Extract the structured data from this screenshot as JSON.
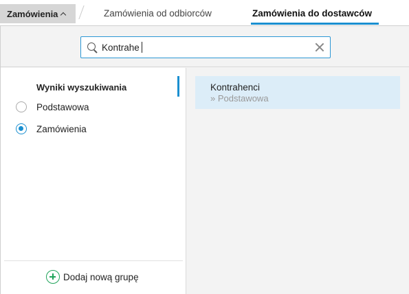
{
  "topbar": {
    "menu_label": "Zamówienia",
    "tabs": [
      {
        "label": "Zamówienia od odbiorców",
        "active": false
      },
      {
        "label": "Zamówienia do dostawców",
        "active": true
      }
    ],
    "accent_color": "#1a8fd0"
  },
  "search": {
    "value": "Kontrahe",
    "icon": "search-icon",
    "clear_icon": "close-icon"
  },
  "left": {
    "header": "Wyniki wyszukiwania",
    "groups": [
      {
        "label": "Podstawowa",
        "selected": false
      },
      {
        "label": "Zamówienia",
        "selected": true
      }
    ],
    "add_group_label": "Dodaj nową grupę",
    "add_icon": "plus-circle-icon",
    "add_icon_color": "#1fa35a"
  },
  "results": [
    {
      "title": "Kontrahenci",
      "path": "» Podstawowa"
    }
  ]
}
